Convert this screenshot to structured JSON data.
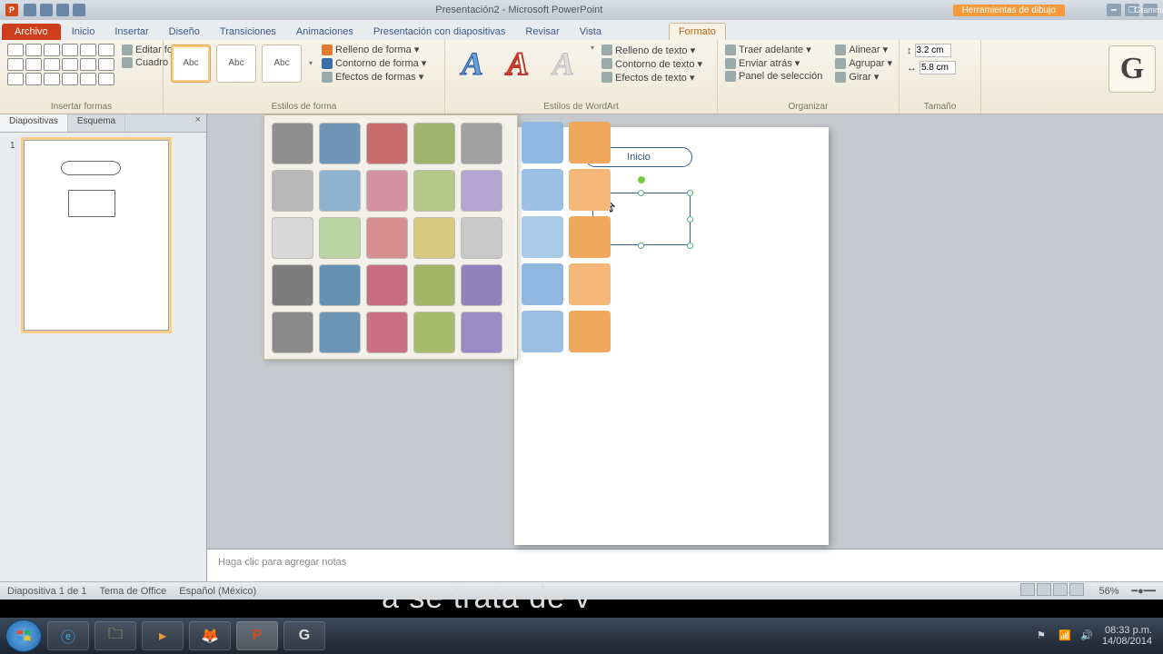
{
  "titlebar": {
    "title": "Presentación2 - Microsoft PowerPoint",
    "context_tab": "Herramientas de dibujo",
    "grammarly": "Gramma"
  },
  "tabs": {
    "file": "Archivo",
    "items": [
      "Inicio",
      "Insertar",
      "Diseño",
      "Transiciones",
      "Animaciones",
      "Presentación con diapositivas",
      "Revisar",
      "Vista"
    ],
    "active": "Formato"
  },
  "ribbon": {
    "insert_shapes": "Insertar formas",
    "edit_shape": "Editar forma ▾",
    "text_box": "Cuadro de texto",
    "shape_styles": "Estilos de forma",
    "abc": "Abc",
    "shape_fill": "Relleno de forma ▾",
    "shape_outline": "Contorno de forma ▾",
    "shape_effects": "Efectos de formas ▾",
    "wordart_styles": "Estilos de WordArt",
    "text_fill": "Relleno de texto ▾",
    "text_outline": "Contorno de texto ▾",
    "text_effects": "Efectos de texto ▾",
    "bring_forward": "Traer adelante ▾",
    "send_backward": "Enviar atrás ▾",
    "selection_pane": "Panel de selección",
    "align": "Alinear ▾",
    "group": "Agrupar ▾",
    "rotate": "Girar ▾",
    "arrange": "Organizar",
    "size": "Tamaño",
    "height": "3.2 cm",
    "width": "5.8 cm"
  },
  "sidebar": {
    "tab_slides": "Diapositivas",
    "tab_outline": "Esquema",
    "slide_num": "1"
  },
  "slide": {
    "start_label": "Inicio"
  },
  "gallery_colors": [
    "#8f8f8f",
    "#6f94b6",
    "#c76d6d",
    "#9fb56f",
    "#a0a0a0",
    "#b8b8b8",
    "#8fb2cf",
    "#d492a4",
    "#b7c98a",
    "#b2a5cf",
    "#d8d8d8",
    "#b9d5a3",
    "#d78e8e",
    "#d9c97f",
    "#c9c9c9",
    "#7d7d7d",
    "#6690b1",
    "#c76d7f",
    "#a4b56a",
    "#9184bd",
    "#8a8a8a",
    "#6a93b4",
    "#cc7185",
    "#a8bb6d",
    "#9a8cc4"
  ],
  "extra_colors1": [
    "#8fb7df",
    "#9cc0e3",
    "#a9c9e7",
    "#8fb7df",
    "#9cc0e3"
  ],
  "extra_colors2": [
    "#f0a95c",
    "#f3b877",
    "#f0a95c",
    "#f3b877",
    "#f0a95c"
  ],
  "notes_placeholder": "Haga clic para agregar notas",
  "status": {
    "slide": "Diapositiva 1 de 1",
    "theme": "Tema de Office",
    "lang": "Español (México)",
    "zoom": "56%"
  },
  "taskbar": {
    "time": "08:33 p.m.",
    "date": "14/08/2014"
  }
}
